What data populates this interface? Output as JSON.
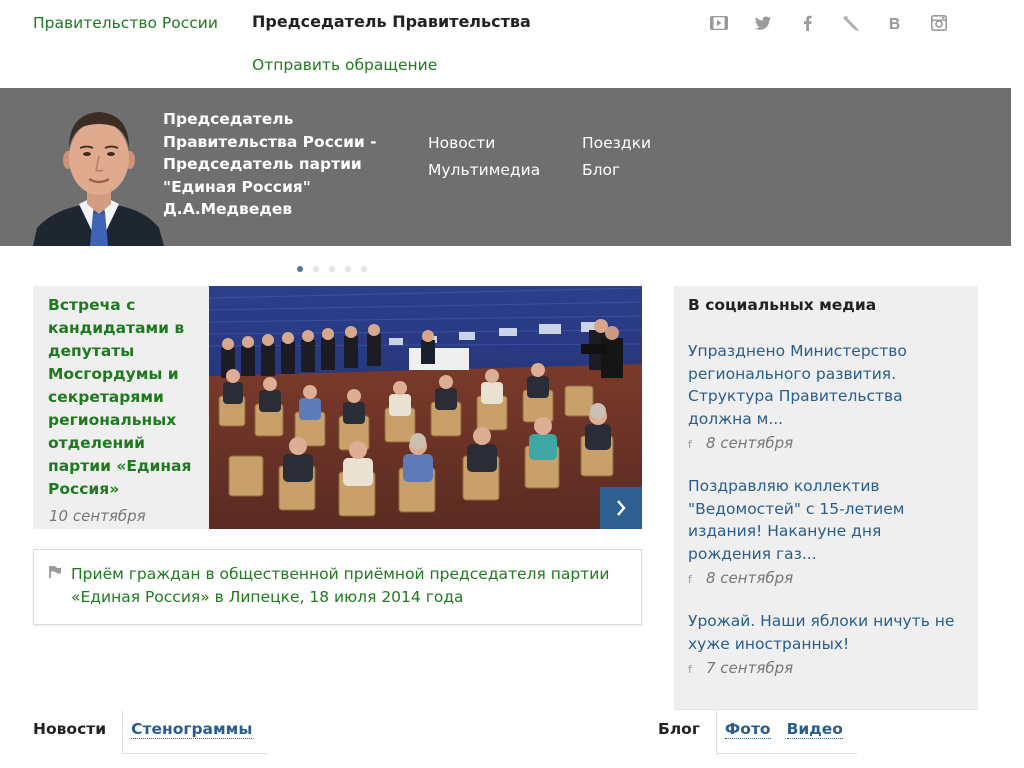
{
  "header": {
    "gov_link": "Правительство России",
    "chair_title": "Председатель Правительства",
    "appeal_link": "Отправить обращение",
    "social_icons": [
      "youtube-icon",
      "twitter-icon",
      "facebook-icon",
      "livejournal-icon",
      "vk-icon",
      "instagram-icon"
    ]
  },
  "banner": {
    "title": "Председатель Правительства России - Председатель партии \"Единая Россия\" Д.А.Медведев",
    "nav_col1": [
      "Новости",
      "Мультимедиа"
    ],
    "nav_col2": [
      "Поездки",
      "Блог"
    ]
  },
  "carousel": {
    "dots": 5,
    "active_index": 0
  },
  "featured": {
    "title": "Встреча с кандидатами в депутаты Мосгордумы и секретарями региональных отделений партии «Единая Россия»",
    "date": "10 сентября"
  },
  "reception": {
    "text": "Приём граждан в общественной приёмной председателя партии «Единая Россия» в Липецке, 18 июля 2014 года"
  },
  "social_media": {
    "heading": "В социальных медиа",
    "posts": [
      {
        "text": "Упразднено Министерство регионального развития. Структура Правительства должна м...",
        "source": "f",
        "date": "8 сентября"
      },
      {
        "text": "Поздравляю коллектив \"Ведомостей\" с 15-летием издания! Накануне дня рождения газ...",
        "source": "f",
        "date": "8 сентября"
      },
      {
        "text": "Урожай. Наши яблоки ничуть не хуже иностранных!",
        "source": "f",
        "date": "7 сентября"
      }
    ]
  },
  "tabs_left": {
    "active": "Новости",
    "link": "Стенограммы"
  },
  "tabs_right": {
    "active": "Блог",
    "links": [
      "Фото",
      "Видео"
    ]
  },
  "colors": {
    "accent_green": "#1f7a1f",
    "link_blue": "#2a5d8f",
    "banner_grey": "#6f6f6f"
  }
}
